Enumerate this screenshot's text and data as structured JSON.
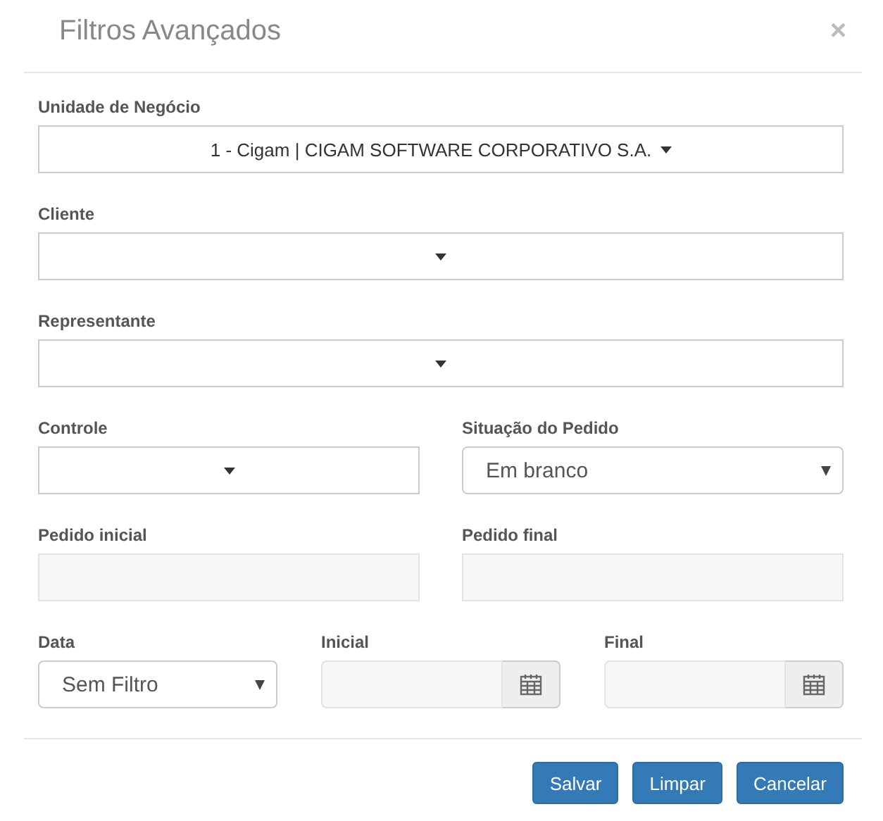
{
  "dialog": {
    "title": "Filtros Avançados",
    "close": "×"
  },
  "rows": [
    {
      "fields": [
        {
          "label": "Unidade de Negócio",
          "kind": "dropdown",
          "value": "1 - Cigam | CIGAM SOFTWARE CORPORATIVO S.A.",
          "disabled": false
        }
      ]
    },
    {
      "fields": [
        {
          "label": "Cliente",
          "kind": "dropdown",
          "disabled": false
        }
      ]
    },
    {
      "fields": [
        {
          "label": "Representante",
          "kind": "dropdown",
          "disabled": false
        }
      ]
    },
    {
      "fields": [
        {
          "label": "Controle",
          "kind": "dropdown",
          "disabled": false
        },
        {
          "label": "Situação do Pedido",
          "kind": "select",
          "value": "Em branco",
          "disabled": false
        }
      ]
    },
    {
      "fields": [
        {
          "label": "Pedido inicial",
          "kind": "text",
          "disabled": true
        },
        {
          "label": "Pedido final",
          "kind": "text",
          "disabled": true
        }
      ]
    },
    {
      "fields": [
        {
          "label": "Data",
          "kind": "select",
          "value": "Sem Filtro",
          "disabled": false
        },
        {
          "label": "Inicial",
          "kind": "date",
          "disabled": true
        },
        {
          "label": "Final",
          "kind": "date",
          "disabled": true
        }
      ]
    }
  ],
  "buttons": [
    "Salvar",
    "Limpar",
    "Cancelar"
  ]
}
